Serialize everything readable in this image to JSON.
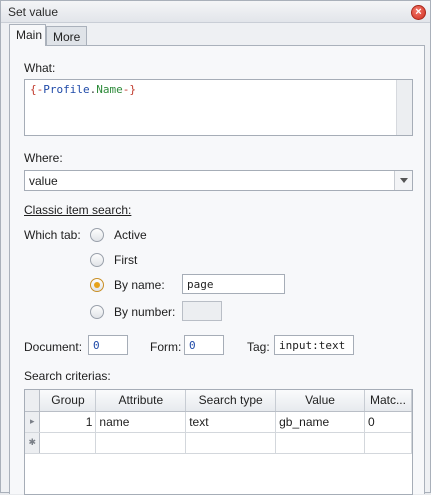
{
  "window": {
    "title": "Set value",
    "close_glyph": "×"
  },
  "tabs": [
    {
      "label": "Main",
      "active": true
    },
    {
      "label": "More",
      "active": false
    }
  ],
  "what": {
    "label": "What:",
    "expr_open": "{-",
    "expr_obj": "Profile",
    "expr_dot": ".",
    "expr_prop": "Name",
    "expr_close": "-}"
  },
  "where": {
    "label": "Where:",
    "value": "value"
  },
  "classic_search_label": "Classic item search:",
  "which_tab": {
    "label": "Which tab:",
    "options": [
      {
        "label": "Active",
        "checked": false
      },
      {
        "label": "First",
        "checked": false
      },
      {
        "label": "By name:",
        "checked": true,
        "value": "page"
      },
      {
        "label": "By number:",
        "checked": false,
        "value": ""
      }
    ]
  },
  "document": {
    "label": "Document:",
    "value": "0"
  },
  "form": {
    "label": "Form:",
    "value": "0"
  },
  "tag": {
    "label": "Tag:",
    "value": "input:text"
  },
  "criteria": {
    "label": "Search criterias:",
    "columns": [
      "Group",
      "Attribute",
      "Search type",
      "Value",
      "Matc..."
    ],
    "rows": [
      {
        "marker": "▸",
        "group": "1",
        "attribute": "name",
        "search_type": "text",
        "value": "gb_name",
        "match": "0"
      },
      {
        "marker": "✱",
        "group": "",
        "attribute": "",
        "search_type": "",
        "value": "",
        "match": ""
      }
    ]
  },
  "colors": {
    "expr_brace": "#c0392b",
    "expr_obj": "#1f4aa8",
    "expr_prop": "#2e8b3a",
    "value_blue": "#1f4aa8",
    "radio_checked": "#e6a21a"
  },
  "icons": {
    "close": "close-icon",
    "dropdown": "chevron-down-icon"
  }
}
